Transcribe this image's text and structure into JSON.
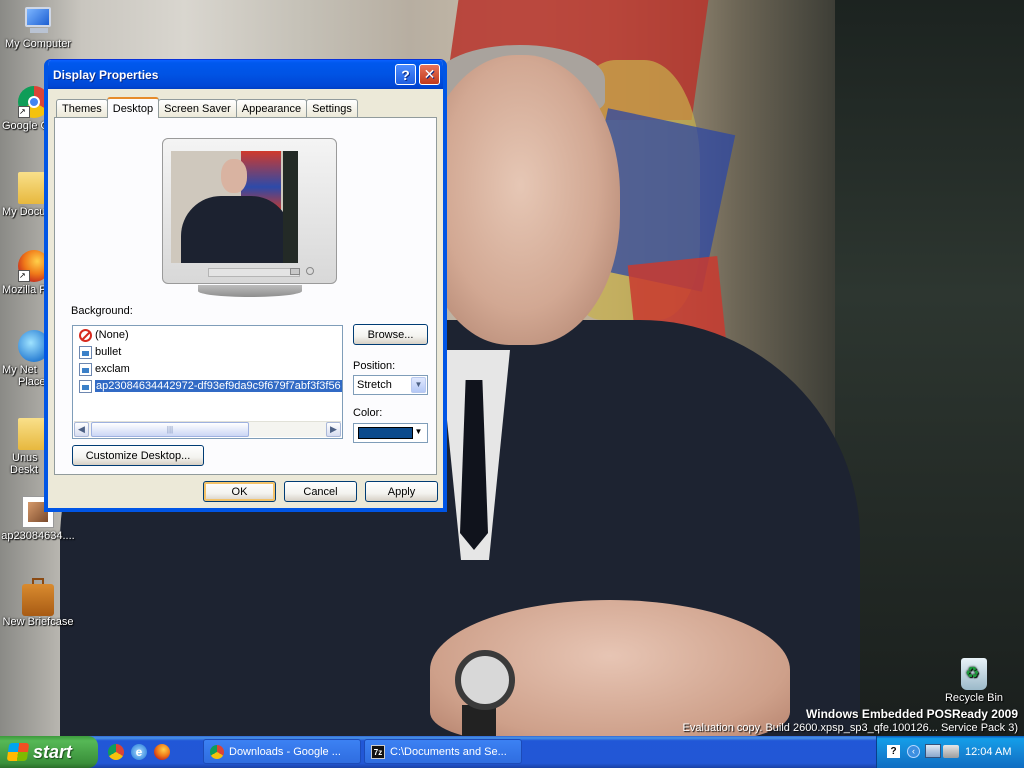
{
  "desktop": {
    "icons": [
      {
        "label": "My Computer",
        "icon": "computer-icon"
      },
      {
        "label": "Google C",
        "icon": "chrome-icon"
      },
      {
        "label": "My Docu",
        "icon": "folder-icon"
      },
      {
        "label": "Mozilla F",
        "icon": "firefox-icon"
      },
      {
        "label": "My Net",
        "label2": "Place",
        "icon": "network-icon"
      },
      {
        "label": "Unus",
        "label2": "Deskt",
        "icon": "folder-icon"
      },
      {
        "label": "ap23084634....",
        "icon": "image-file-icon"
      },
      {
        "label": "New Briefcase",
        "icon": "briefcase-icon"
      },
      {
        "label": "Recycle Bin",
        "icon": "recycle-bin-icon"
      }
    ],
    "watermark": {
      "line1": "Windows Embedded POSReady 2009",
      "line2": "Evaluation copy. Build 2600.xpsp_sp3_qfe.100126... Service Pack 3)"
    }
  },
  "dialog": {
    "title": "Display Properties",
    "tabs": [
      "Themes",
      "Desktop",
      "Screen Saver",
      "Appearance",
      "Settings"
    ],
    "active_tab": "Desktop",
    "background_label": "Background:",
    "background_items": [
      "(None)",
      "bullet",
      "exclam",
      "ap23084634442972-df93ef9da9c9f679f7abf3f3f56"
    ],
    "selected_item": "ap23084634442972-df93ef9da9c9f679f7abf3f3f56",
    "browse_label": "Browse...",
    "position_label": "Position:",
    "position_value": "Stretch",
    "color_label": "Color:",
    "color_value": "#0b4a8c",
    "customize_label": "Customize Desktop...",
    "ok_label": "OK",
    "cancel_label": "Cancel",
    "apply_label": "Apply",
    "help_glyph": "?",
    "close_glyph": "✕"
  },
  "taskbar": {
    "start_label": "start",
    "quick_launch": [
      "chrome-icon",
      "ie-icon",
      "firefox-icon"
    ],
    "items": [
      {
        "label": "Downloads - Google ...",
        "icon": "chrome-icon"
      },
      {
        "label": "C:\\Documents and Se...",
        "icon": "7zip-icon"
      }
    ],
    "clock": "12:04 AM"
  }
}
